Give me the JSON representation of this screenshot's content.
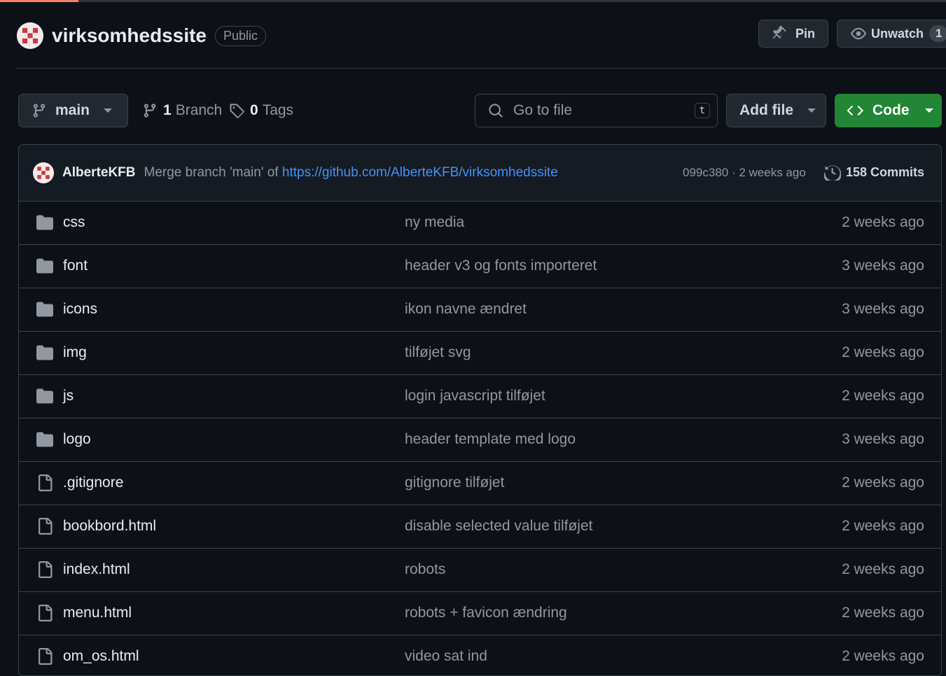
{
  "repo": {
    "name": "virksomhedssite",
    "visibility": "Public",
    "pin_label": "Pin",
    "watch_label": "Unwatch",
    "watch_count": "1"
  },
  "toolbar": {
    "branch": "main",
    "branch_count": "1",
    "branch_label": "Branch",
    "tag_count": "0",
    "tag_label": "Tags",
    "search_placeholder": "Go to file",
    "search_shortcut": "t",
    "add_file_label": "Add file",
    "code_label": "Code"
  },
  "commit": {
    "author": "AlberteKFB",
    "message": "Merge branch 'main' of",
    "link": "https://github.com/AlberteKFB/virksomhedssite",
    "hash_time": "099c380 · 2 weeks ago",
    "commits_label": "158 Commits"
  },
  "files": [
    {
      "name": "css",
      "type": "folder",
      "message": "ny media",
      "date": "2 weeks ago"
    },
    {
      "name": "font",
      "type": "folder",
      "message": "header v3 og fonts importeret",
      "date": "3 weeks ago"
    },
    {
      "name": "icons",
      "type": "folder",
      "message": "ikon navne ændret",
      "date": "3 weeks ago"
    },
    {
      "name": "img",
      "type": "folder",
      "message": "tilføjet svg",
      "date": "2 weeks ago"
    },
    {
      "name": "js",
      "type": "folder",
      "message": "login javascript tilføjet",
      "date": "2 weeks ago"
    },
    {
      "name": "logo",
      "type": "folder",
      "message": "header template med logo",
      "date": "3 weeks ago"
    },
    {
      "name": ".gitignore",
      "type": "file",
      "message": "gitignore tilføjet",
      "date": "2 weeks ago"
    },
    {
      "name": "bookbord.html",
      "type": "file",
      "message": "disable selected value tilføjet",
      "date": "2 weeks ago"
    },
    {
      "name": "index.html",
      "type": "file",
      "message": "robots",
      "date": "2 weeks ago"
    },
    {
      "name": "menu.html",
      "type": "file",
      "message": "robots + favicon ændring",
      "date": "2 weeks ago"
    },
    {
      "name": "om_os.html",
      "type": "file",
      "message": "video sat ind",
      "date": "2 weeks ago"
    }
  ]
}
